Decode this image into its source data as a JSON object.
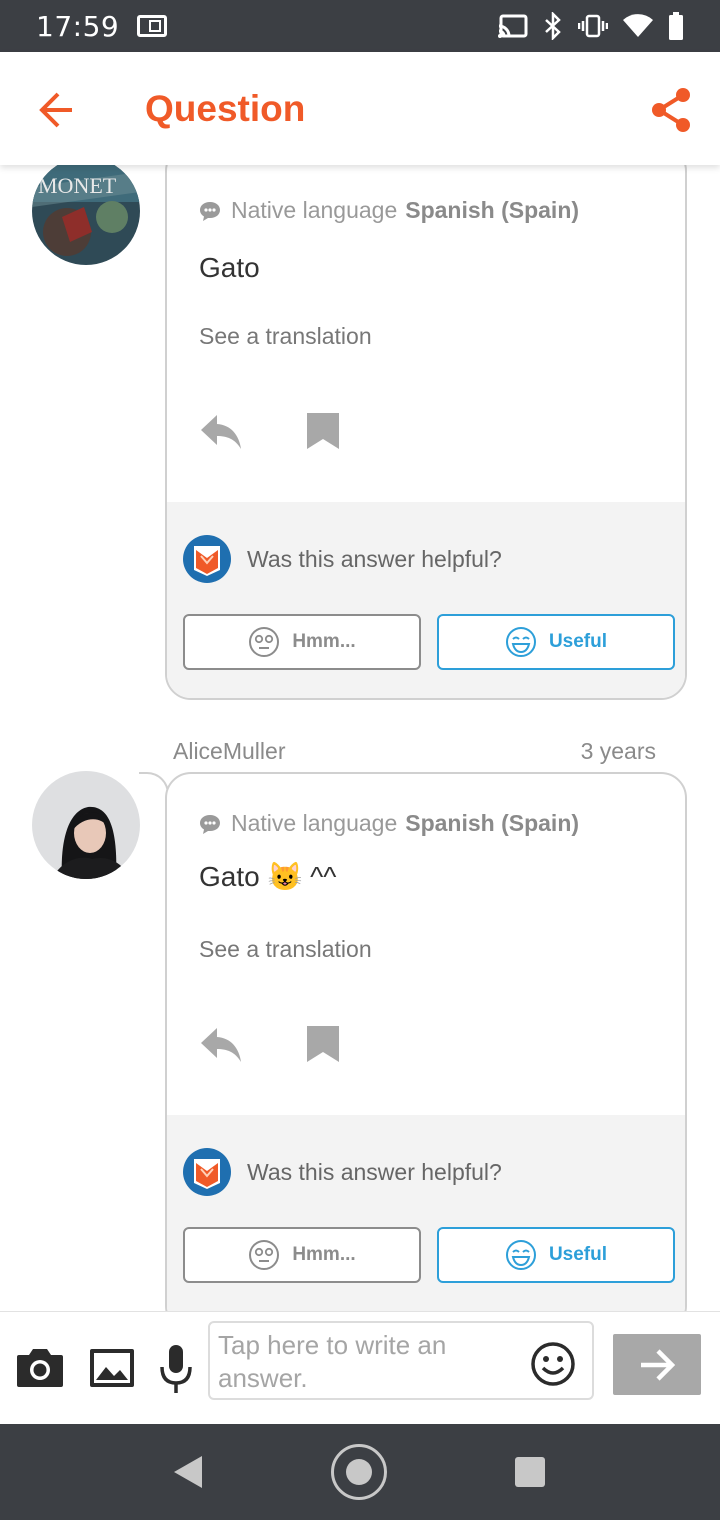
{
  "status_bar": {
    "time": "17:59"
  },
  "app_bar": {
    "title": "Question"
  },
  "answers": [
    {
      "user": "",
      "time": "",
      "native_label": "Native language",
      "native_language": "Spanish (Spain)",
      "text": "Gato",
      "translation_link": "See a translation",
      "helpful_question": "Was this answer helpful?",
      "hmm_label": "Hmm...",
      "useful_label": "Useful"
    },
    {
      "user": "AliceMuller",
      "time": "3 years",
      "native_label": "Native language",
      "native_language": "Spanish (Spain)",
      "text": "Gato 😺 ^^",
      "translation_link": "See a translation",
      "helpful_question": "Was this answer helpful?",
      "hmm_label": "Hmm...",
      "useful_label": "Useful"
    }
  ],
  "input_bar": {
    "placeholder": "Tap here to write an answer."
  },
  "icons": {
    "back": "arrow-left-icon",
    "share": "share-icon",
    "camera": "camera-icon",
    "image": "image-icon",
    "mic": "microphone-icon",
    "emoji": "emoji-icon",
    "send": "arrow-right-icon"
  },
  "colors": {
    "brand": "#f05a28",
    "useful": "#2d9fd9",
    "status_bar": "#3c3f44",
    "send_disabled": "#a8a8a8"
  }
}
